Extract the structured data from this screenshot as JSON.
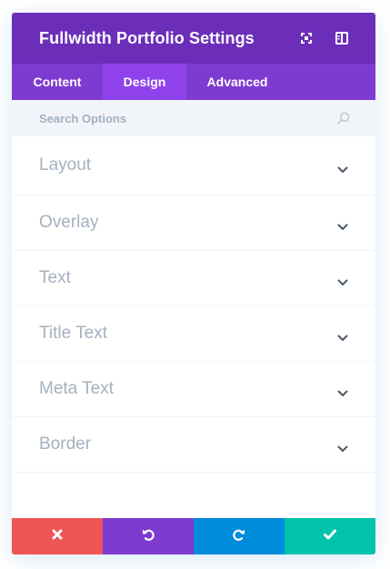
{
  "modal": {
    "title": "Fullwidth Portfolio Settings",
    "icons": [
      "expand-icon",
      "sidebar-layout-icon"
    ]
  },
  "tabs": [
    {
      "label": "Content",
      "active": false
    },
    {
      "label": "Design",
      "active": true
    },
    {
      "label": "Advanced",
      "active": false
    }
  ],
  "search": {
    "placeholder": "Search Options",
    "value": ""
  },
  "groups": [
    {
      "label": "Layout"
    },
    {
      "label": "Overlay"
    },
    {
      "label": "Text"
    },
    {
      "label": "Title Text"
    },
    {
      "label": "Meta Text"
    },
    {
      "label": "Border"
    }
  ],
  "footer": [
    {
      "name": "discard-button",
      "icon": "close-icon",
      "color": "#ef5555"
    },
    {
      "name": "undo-button",
      "icon": "undo-icon",
      "color": "#7e3bd0"
    },
    {
      "name": "redo-button",
      "icon": "redo-icon",
      "color": "#008bdb"
    },
    {
      "name": "save-button",
      "icon": "check-icon",
      "color": "#00c3aa"
    }
  ],
  "colors": {
    "header": "#6c2eb9",
    "tabs": "#7e3bd0",
    "active_tab": "#8f42ec",
    "muted_text": "#a3b1bf",
    "chevron": "#4c5866"
  }
}
